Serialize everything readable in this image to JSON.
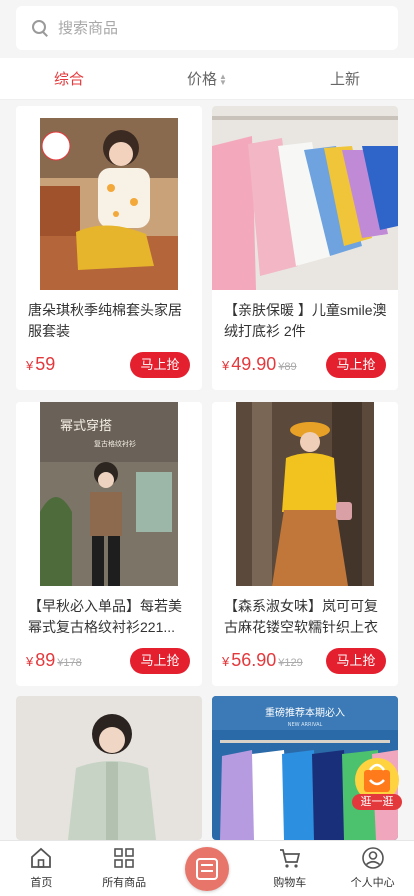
{
  "search": {
    "placeholder": "搜索商品"
  },
  "sort_tabs": [
    {
      "label": "综合",
      "active": true
    },
    {
      "label": "价格",
      "sortable": true
    },
    {
      "label": "上新"
    }
  ],
  "products": [
    {
      "title": "唐朵琪秋季纯棉套头家居服套装",
      "price": "59",
      "original_price": "",
      "buy_label": "马上抢"
    },
    {
      "title": "【亲肤保暖 】儿童smile澳绒打底衫 2件",
      "price": "49.90",
      "original_price": "89",
      "buy_label": "马上抢"
    },
    {
      "title": "【早秋必入单品】每若美幂式复古格纹衬衫221...",
      "price": "89",
      "original_price": "178",
      "buy_label": "马上抢"
    },
    {
      "title": "【森系淑女味】岚可可复古麻花镂空软糯针织上衣",
      "price": "56.90",
      "original_price": "129",
      "buy_label": "马上抢"
    },
    {
      "title": "",
      "price": "",
      "original_price": "",
      "buy_label": ""
    },
    {
      "title": "",
      "price": "",
      "original_price": "",
      "buy_label": ""
    }
  ],
  "image_text": {
    "p3_heading": "幂式穿搭",
    "p3_sub": "复古格纹衬衫",
    "p6_banner": "重磅推荐本期必入",
    "p6_sub": "NEW ARRIVAL"
  },
  "currency": "¥",
  "float_badge": {
    "label": "逛一逛"
  },
  "bottom_nav": [
    {
      "label": "首页",
      "icon": "home-icon"
    },
    {
      "label": "所有商品",
      "icon": "grid-icon"
    },
    {
      "label": "",
      "icon": "center-menu-icon"
    },
    {
      "label": "购物车",
      "icon": "cart-icon"
    },
    {
      "label": "个人中心",
      "icon": "user-icon"
    }
  ],
  "colors": {
    "accent": "#e4393c",
    "buy_button": "#e41f2e",
    "center_button": "#e8756a"
  }
}
